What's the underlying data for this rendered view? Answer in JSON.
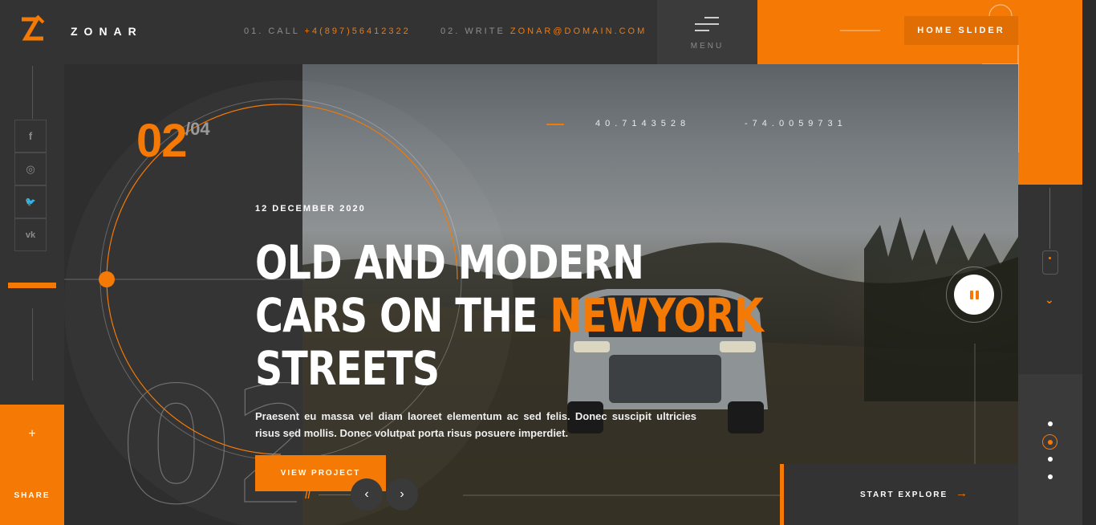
{
  "brand": {
    "name": "ZONAR"
  },
  "header": {
    "call_label": "01. CALL",
    "phone": "+4(897)56412322",
    "write_label": "02. WRITE",
    "email": "ZONAR@DOMAIN.COM",
    "menu_label": "MENU",
    "home_slider": "HOME SLIDER"
  },
  "social": [
    {
      "icon": "facebook-icon",
      "glyph": "f"
    },
    {
      "icon": "instagram-icon",
      "glyph": "◎"
    },
    {
      "icon": "twitter-icon",
      "glyph": "🐦"
    },
    {
      "icon": "vk-icon",
      "glyph": "vk"
    }
  ],
  "share": {
    "plus": "+",
    "label": "SHARE"
  },
  "slider": {
    "current": "02",
    "total": "/04",
    "big_number": "02",
    "date": "12 DECEMBER 2020",
    "headline_line1": "OLD AND MODERN",
    "headline_line2": "CARS ON THE ",
    "headline_highlight": "NEWYORK",
    "headline_line3": "STREETS",
    "description": "Praesent eu massa vel diam laoreet elementum ac sed felis. Donec suscipit ultricies risus sed mollis. Donec volutpat porta risus posuere imperdiet.",
    "view_button": "VIEW PROJECT",
    "slash": "//",
    "prev_glyph": "‹",
    "next_glyph": "›"
  },
  "coords": {
    "lat": "40.7143528",
    "lng": "-74.0059731"
  },
  "explore": {
    "label": "START EXPLORE",
    "arrow": "→"
  },
  "scroll": {
    "chevron": "⌄"
  },
  "pager": {
    "count": 4,
    "active_index": 1
  },
  "colors": {
    "accent": "#f57a05",
    "dark": "#2b2b2b",
    "panel": "#333333"
  }
}
